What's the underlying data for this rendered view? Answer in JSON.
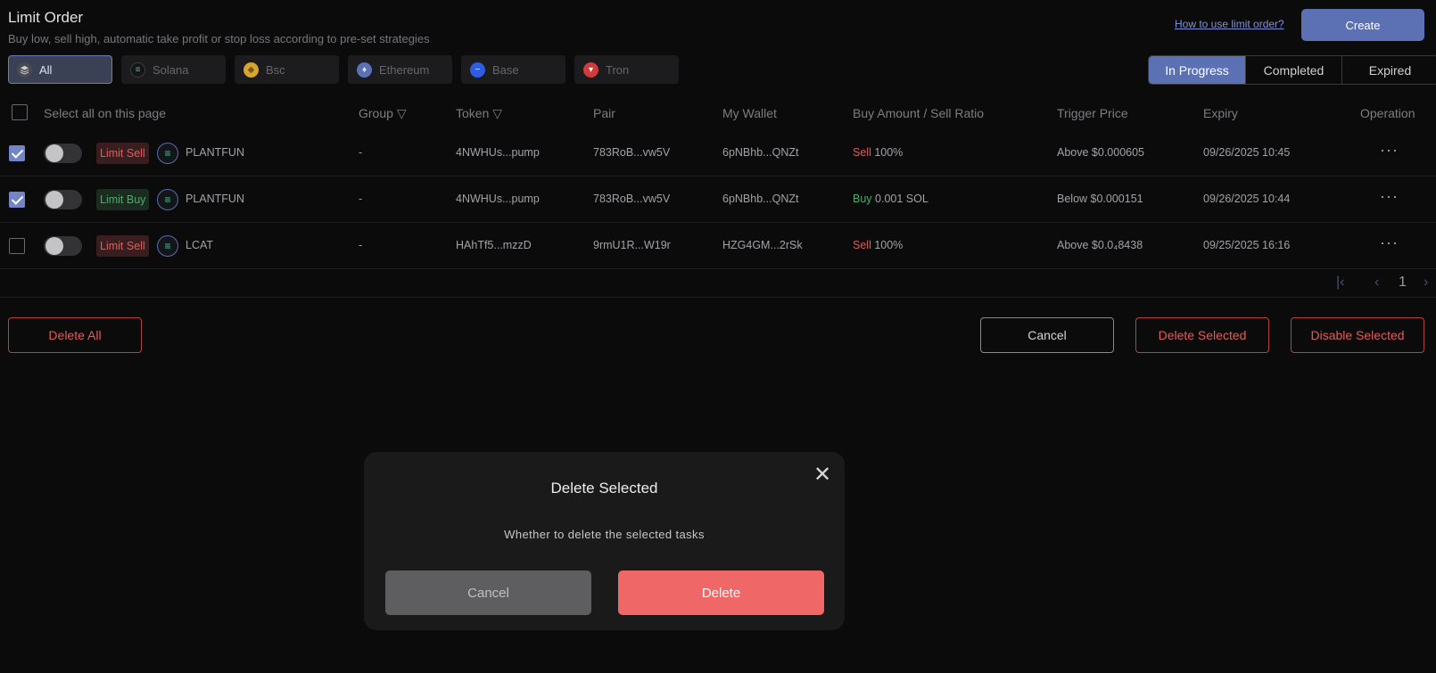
{
  "header": {
    "title": "Limit Order",
    "subtitle": "Buy low, sell high, automatic take profit or stop loss according to pre-set strategies",
    "help_link": "How to use limit order?",
    "create_label": "Create"
  },
  "chains": [
    {
      "label": "All",
      "icon": "layers-icon",
      "color": "#8f8f95",
      "active": true
    },
    {
      "label": "Solana",
      "icon": "solana-icon",
      "color": "#3ac7b0"
    },
    {
      "label": "Bsc",
      "icon": "bsc-icon",
      "color": "#d6a630"
    },
    {
      "label": "Ethereum",
      "icon": "ethereum-icon",
      "color": "#5c70b4"
    },
    {
      "label": "Base",
      "icon": "base-icon",
      "color": "#2f5ce0"
    },
    {
      "label": "Tron",
      "icon": "tron-icon",
      "color": "#d33a3a"
    }
  ],
  "status_tabs": [
    {
      "label": "In Progress",
      "active": true
    },
    {
      "label": "Completed"
    },
    {
      "label": "Expired"
    }
  ],
  "table": {
    "select_all": "Select all on this page",
    "columns": {
      "group": "Group",
      "token": "Token",
      "pair": "Pair",
      "wallet": "My Wallet",
      "amount": "Buy Amount / Sell Ratio",
      "trigger": "Trigger Price",
      "expiry": "Expiry",
      "operation": "Operation"
    },
    "rows": [
      {
        "checked": true,
        "type": "Limit Sell",
        "side": "sell",
        "token_name": "PLANTFUN",
        "group": "-",
        "token": "4NWHUs...pump",
        "pair": "783RoB...vw5V",
        "wallet": "6pNBhb...QNZt",
        "action": "Sell",
        "amount": "100%",
        "trigger": "Above $0.000605",
        "expiry": "09/26/2025 10:45",
        "ops": "···"
      },
      {
        "checked": true,
        "type": "Limit Buy",
        "side": "buy",
        "token_name": "PLANTFUN",
        "group": "-",
        "token": "4NWHUs...pump",
        "pair": "783RoB...vw5V",
        "wallet": "6pNBhb...QNZt",
        "action": "Buy",
        "amount": "0.001 SOL",
        "trigger": "Below $0.000151",
        "expiry": "09/26/2025 10:44",
        "ops": "···"
      },
      {
        "checked": false,
        "type": "Limit Sell",
        "side": "sell",
        "token_name": "LCAT",
        "group": "-",
        "token": "HAhTf5...mzzD",
        "pair": "9rmU1R...W19r",
        "wallet": "HZG4GM...2rSk",
        "action": "Sell",
        "amount": "100%",
        "trigger": "Above $0.0₄8438",
        "expiry": "09/25/2025 16:16",
        "ops": "···"
      }
    ]
  },
  "pagination": {
    "first": "|‹",
    "prev": "‹",
    "page": "1",
    "next": "›"
  },
  "actions": {
    "delete_all": "Delete All",
    "cancel": "Cancel",
    "delete_selected": "Delete Selected",
    "disable_selected": "Disable Selected"
  },
  "modal": {
    "title": "Delete Selected",
    "message": "Whether to delete the selected tasks",
    "cancel": "Cancel",
    "delete": "Delete",
    "close": "✕"
  }
}
